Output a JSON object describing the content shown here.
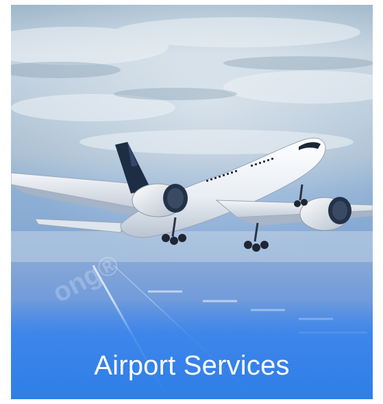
{
  "card": {
    "title": "Airport Services",
    "image_subject": "airplane-taking-off",
    "overlay_color": "#2f7fe6",
    "watermark": "ong®"
  }
}
